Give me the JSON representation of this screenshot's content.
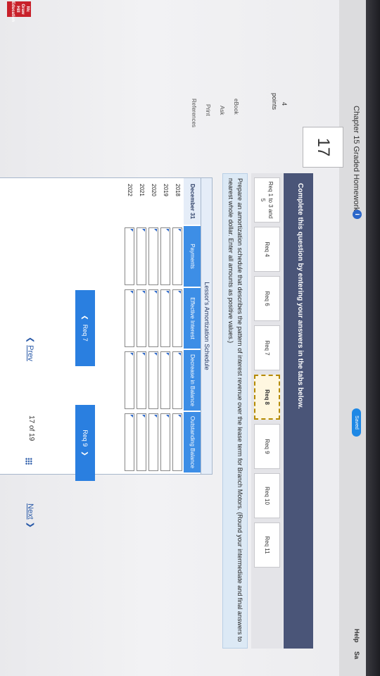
{
  "header": {
    "chapter_title": "Chapter 15 Graded Homework",
    "info_badge": "i",
    "saved_label": "Saved",
    "help_label": "Help",
    "save_label": "Sa"
  },
  "question": {
    "number": "17",
    "points_value": "4",
    "points_label": "points"
  },
  "sidebar": {
    "ebook": "eBook",
    "ask": "Ask",
    "print": "Print",
    "references": "References"
  },
  "banner": {
    "text": "Complete this question by entering your answers in the tabs below."
  },
  "tabs": [
    {
      "label": "Req 1 to 3 and 5"
    },
    {
      "label": "Req 4"
    },
    {
      "label": "Req 6"
    },
    {
      "label": "Req 7"
    },
    {
      "label": "Req 8"
    },
    {
      "label": "Req 9"
    },
    {
      "label": "Req 10"
    },
    {
      "label": "Req 11"
    }
  ],
  "instructions": "Prepare an amortization schedule that describes the pattern of interest revenue over the lease term for Branch Motors. (Round your intermediate and final answers to nearest whole dollar. Enter all amounts as positive values.)",
  "schedule": {
    "title": "Lessor's Amortization Schedule",
    "columns": [
      "December 31",
      "Payments",
      "Effective Interest",
      "Decrease in Balance",
      "Outstanding Balance"
    ],
    "rows": [
      "2018",
      "2019",
      "2020",
      "2021",
      "2022"
    ]
  },
  "buttons": {
    "prev_req": "Req 7",
    "next_req": "Req 9"
  },
  "footer": {
    "prev": "Prev",
    "position": "17 of 19",
    "next": "Next"
  },
  "logo": {
    "text": "Mc Graw Hill Education"
  },
  "colors": {
    "banner": "#4a5578",
    "header_blue": "#3d8ee6",
    "button_blue": "#2a7fe0",
    "logo_red": "#c8202a"
  }
}
